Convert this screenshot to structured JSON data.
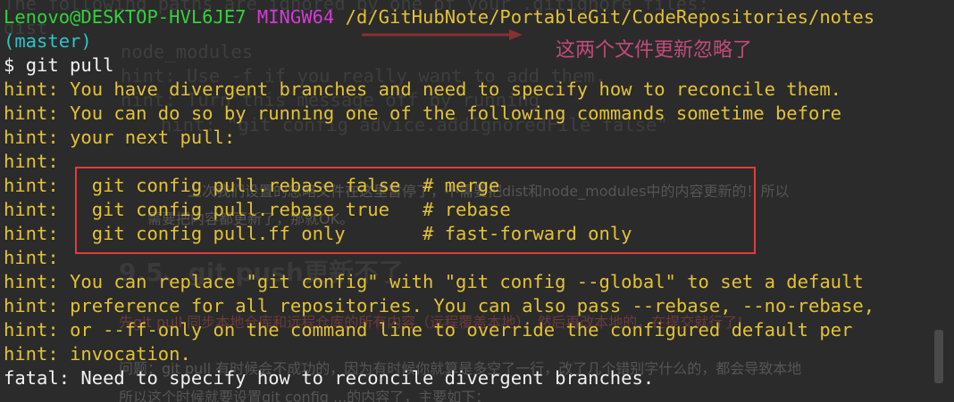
{
  "background": {
    "terminal_ghost_lines": [
      "The following paths are ignored by one of your .gitignore files:",
      "dist",
      "node_modules",
      "hint: Use -f if you really want to add them.",
      "hint: Turn this message off by running",
      "hint: \"git config advice.addIgnoredFile false\""
    ],
    "annotation": "这两个文件更新忽略了",
    "doc_line_1": "上次我们设置的忽略文件在这里暂停了，不需要把dist和node_modules中的内容更新的！所以",
    "doc_line_2": "需要把内容都更新了，那就OK。",
    "doc_heading": "9.5、git push更新不了",
    "doc_line_3": "先git pull 同步本地仓库和远程仓库的所有内容（远程覆盖本地），然后再改本地的，在提交就行了!",
    "doc_line_4": "问题：git pull 有时候会不成功的，因为有时候你就算是多空了一行，改了几个错别字什么的，都会导致本地",
    "doc_line_5": "所以这个时候就要设置git config ...的内容了，主要如下：",
    "colors": {
      "annotation": "#c24a7a",
      "arrow": "#d43a3a"
    }
  },
  "terminal": {
    "prompt": {
      "user_host": "Lenovo@DESKTOP-HVL6JE7",
      "shell": "MINGW64",
      "path": "/d/GitHubNote/PortableGit/CodeRepositories/notes",
      "branch": "(master)",
      "symbol": "$",
      "command": "git pull"
    },
    "hint_prefix": "hint:",
    "hints": [
      "You have divergent branches and need to specify how to reconcile them.",
      "You can do so by running one of the following commands sometime before",
      "your next pull:",
      "",
      "  git config pull.rebase false  # merge",
      "  git config pull.rebase true   # rebase",
      "  git config pull.ff only       # fast-forward only",
      "",
      "You can replace \"git config\" with \"git config --global\" to set a default",
      "preference for all repositories. You can also pass --rebase, --no-rebase,",
      "or --ff-only on the command line to override the configured default per",
      "invocation."
    ],
    "fatal": "fatal: Need to specify how to reconcile divergent branches.",
    "colors": {
      "user_host": "#33d13c",
      "shell": "#d23bd6",
      "path": "#e3c234",
      "branch": "#2fc3c7",
      "hint": "#e3c234",
      "text": "#f2f2f2",
      "highlight_box": "#e23b3b"
    }
  }
}
